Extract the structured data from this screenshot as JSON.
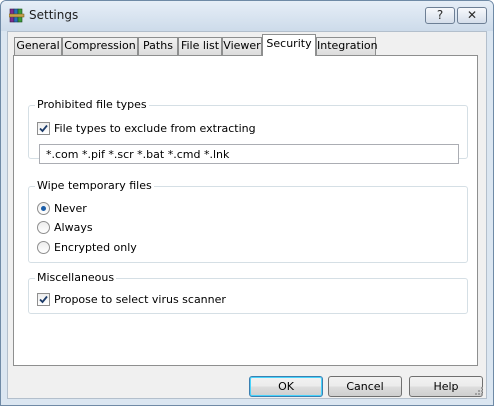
{
  "window": {
    "title": "Settings",
    "help_caption": "?",
    "close_caption": "✕"
  },
  "tabs": [
    {
      "label": "General"
    },
    {
      "label": "Compression"
    },
    {
      "label": "Paths"
    },
    {
      "label": "File list"
    },
    {
      "label": "Viewer"
    },
    {
      "label": "Security",
      "active": true
    },
    {
      "label": "Integration"
    }
  ],
  "prohibited": {
    "title": "Prohibited file types",
    "checkbox_label": "File types to exclude from extracting",
    "checkbox_checked": true,
    "extensions_value": "*.com *.pif *.scr *.bat *.cmd *.lnk"
  },
  "wipe": {
    "title": "Wipe temporary files",
    "options": [
      {
        "label": "Never",
        "selected": true
      },
      {
        "label": "Always",
        "selected": false
      },
      {
        "label": "Encrypted only",
        "selected": false
      }
    ]
  },
  "misc": {
    "title": "Miscellaneous",
    "checkbox_label": "Propose to select virus scanner",
    "checkbox_checked": true
  },
  "buttons": {
    "ok": "OK",
    "cancel": "Cancel",
    "help": "Help"
  },
  "colors": {
    "window_frame": "#dbe6f1",
    "dialog_bg": "#f0f0f0",
    "accent": "#1b5da8"
  },
  "icons": {
    "app": "winrar-books-icon",
    "check": "check-mark-icon"
  }
}
